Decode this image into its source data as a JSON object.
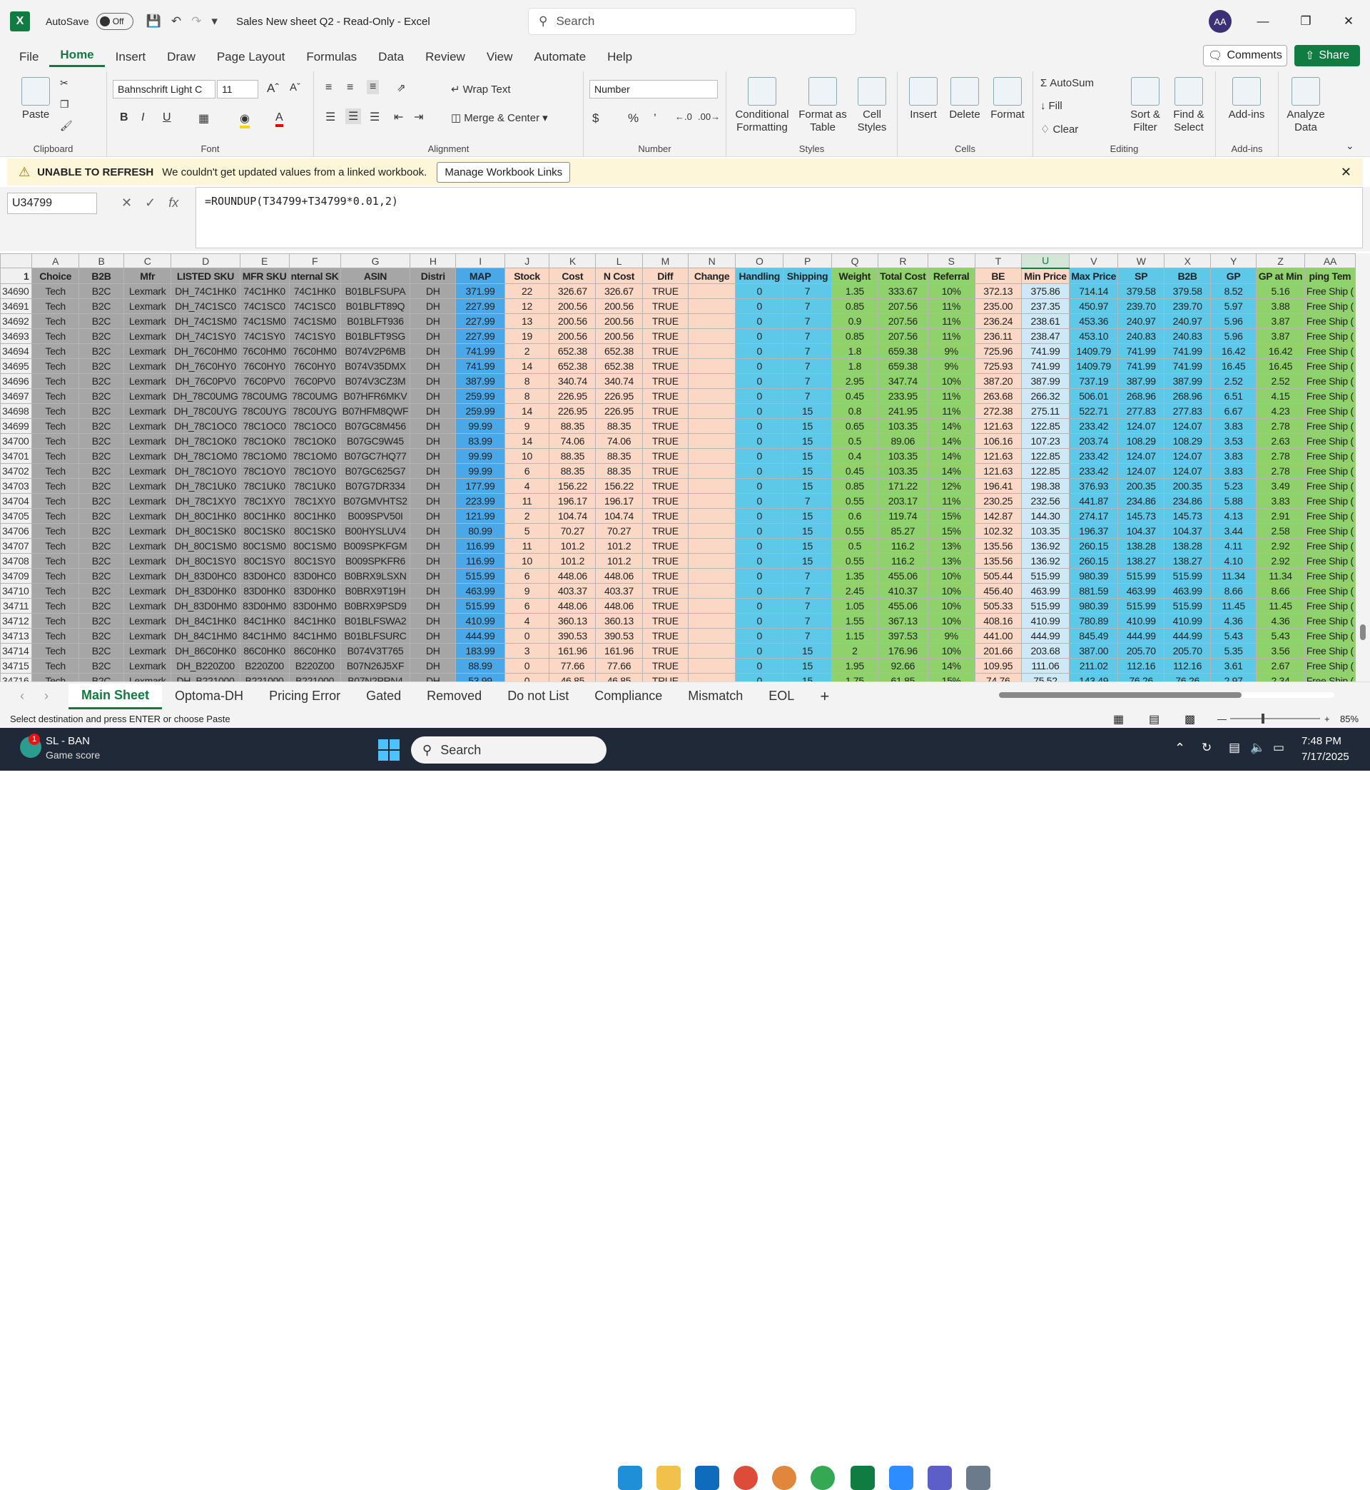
{
  "titlebar": {
    "autosave": "AutoSave",
    "toggle": "Off",
    "title": "Sales New sheet Q2  -  Read-Only  -  Excel",
    "search": "Search",
    "avatar": "AA"
  },
  "menu": [
    "File",
    "Home",
    "Insert",
    "Draw",
    "Page Layout",
    "Formulas",
    "Data",
    "Review",
    "View",
    "Automate",
    "Help"
  ],
  "comments": "Comments",
  "share": "Share",
  "ribbon": {
    "paste": "Paste",
    "clipboard": "Clipboard",
    "font_name": "Bahnschrift Light C",
    "font_size": "11",
    "font": "Font",
    "wrap": "Wrap Text",
    "merge": "Merge & Center",
    "alignment": "Alignment",
    "number_format": "Number",
    "number": "Number",
    "cond": "Conditional Formatting",
    "fmt_table": "Format as Table",
    "cell_styles": "Cell Styles",
    "styles": "Styles",
    "insert": "Insert",
    "delete": "Delete",
    "format": "Format",
    "cells": "Cells",
    "autosum": "AutoSum",
    "fill": "Fill",
    "clear": "Clear",
    "sort": "Sort & Filter",
    "find": "Find & Select",
    "editing": "Editing",
    "addins": "Add-ins",
    "addins_grp": "Add-ins",
    "analyze": "Analyze Data"
  },
  "warning": {
    "title": "UNABLE TO REFRESH",
    "message": "We couldn't get updated values from a linked workbook.",
    "button": "Manage Workbook Links"
  },
  "formula_bar": {
    "namebox": "U34799",
    "formula": "=ROUNDUP(T34799+T34799*0.01,2)"
  },
  "columns": [
    "A",
    "B",
    "C",
    "D",
    "E",
    "F",
    "G",
    "H",
    "I",
    "J",
    "K",
    "L",
    "M",
    "N",
    "O",
    "P",
    "Q",
    "R",
    "S",
    "T",
    "U",
    "V",
    "W",
    "X",
    "Y",
    "Z",
    "AA"
  ],
  "headers": [
    "Choice",
    "B2B",
    "Mfr",
    "LISTED SKU",
    "MFR SKU",
    "nternal SK",
    "ASIN",
    "Distri",
    "MAP",
    "Stock",
    "Cost",
    "N Cost",
    "Diff",
    "Change",
    "Handling",
    "Shipping",
    "Weight",
    "Total Cost",
    "Referral",
    "BE",
    "Min Price",
    "Max Price",
    "SP",
    "B2B",
    "GP",
    "GP at Min",
    "ping Tem"
  ],
  "rows": [
    [
      "34690",
      "Tech",
      "B2C",
      "Lexmark",
      "DH_74C1HK0",
      "74C1HK0",
      "74C1HK0",
      "B01BLFSUPA",
      "DH",
      "371.99",
      "22",
      "326.67",
      "326.67",
      "TRUE",
      "",
      "0",
      "7",
      "1.35",
      "333.67",
      "10%",
      "372.13",
      "375.86",
      "714.14",
      "379.58",
      "379.58",
      "8.52",
      "5.16",
      "Free Ship ("
    ],
    [
      "34691",
      "Tech",
      "B2C",
      "Lexmark",
      "DH_74C1SC0",
      "74C1SC0",
      "74C1SC0",
      "B01BLFT89Q",
      "DH",
      "227.99",
      "12",
      "200.56",
      "200.56",
      "TRUE",
      "",
      "0",
      "7",
      "0.85",
      "207.56",
      "11%",
      "235.00",
      "237.35",
      "450.97",
      "239.70",
      "239.70",
      "5.97",
      "3.88",
      "Free Ship ("
    ],
    [
      "34692",
      "Tech",
      "B2C",
      "Lexmark",
      "DH_74C1SM0",
      "74C1SM0",
      "74C1SM0",
      "B01BLFT936",
      "DH",
      "227.99",
      "13",
      "200.56",
      "200.56",
      "TRUE",
      "",
      "0",
      "7",
      "0.9",
      "207.56",
      "11%",
      "236.24",
      "238.61",
      "453.36",
      "240.97",
      "240.97",
      "5.96",
      "3.87",
      "Free Ship ("
    ],
    [
      "34693",
      "Tech",
      "B2C",
      "Lexmark",
      "DH_74C1SY0",
      "74C1SY0",
      "74C1SY0",
      "B01BLFT9SG",
      "DH",
      "227.99",
      "19",
      "200.56",
      "200.56",
      "TRUE",
      "",
      "0",
      "7",
      "0.85",
      "207.56",
      "11%",
      "236.11",
      "238.47",
      "453.10",
      "240.83",
      "240.83",
      "5.96",
      "3.87",
      "Free Ship ("
    ],
    [
      "34694",
      "Tech",
      "B2C",
      "Lexmark",
      "DH_76C0HM0",
      "76C0HM0",
      "76C0HM0",
      "B074V2P6MB",
      "DH",
      "741.99",
      "2",
      "652.38",
      "652.38",
      "TRUE",
      "",
      "0",
      "7",
      "1.8",
      "659.38",
      "9%",
      "725.96",
      "741.99",
      "1409.79",
      "741.99",
      "741.99",
      "16.42",
      "16.42",
      "Free Ship ("
    ],
    [
      "34695",
      "Tech",
      "B2C",
      "Lexmark",
      "DH_76C0HY0",
      "76C0HY0",
      "76C0HY0",
      "B074V35DMX",
      "DH",
      "741.99",
      "14",
      "652.38",
      "652.38",
      "TRUE",
      "",
      "0",
      "7",
      "1.8",
      "659.38",
      "9%",
      "725.93",
      "741.99",
      "1409.79",
      "741.99",
      "741.99",
      "16.45",
      "16.45",
      "Free Ship ("
    ],
    [
      "34696",
      "Tech",
      "B2C",
      "Lexmark",
      "DH_76C0PV0",
      "76C0PV0",
      "76C0PV0",
      "B074V3CZ3M",
      "DH",
      "387.99",
      "8",
      "340.74",
      "340.74",
      "TRUE",
      "",
      "0",
      "7",
      "2.95",
      "347.74",
      "10%",
      "387.20",
      "387.99",
      "737.19",
      "387.99",
      "387.99",
      "2.52",
      "2.52",
      "Free Ship ("
    ],
    [
      "34697",
      "Tech",
      "B2C",
      "Lexmark",
      "DH_78C0UMG",
      "78C0UMG",
      "78C0UMG",
      "B07HFR6MKV",
      "DH",
      "259.99",
      "8",
      "226.95",
      "226.95",
      "TRUE",
      "",
      "0",
      "7",
      "0.45",
      "233.95",
      "11%",
      "263.68",
      "266.32",
      "506.01",
      "268.96",
      "268.96",
      "6.51",
      "4.15",
      "Free Ship ("
    ],
    [
      "34698",
      "Tech",
      "B2C",
      "Lexmark",
      "DH_78C0UYG",
      "78C0UYG",
      "78C0UYG",
      "B07HFM8QWF",
      "DH",
      "259.99",
      "14",
      "226.95",
      "226.95",
      "TRUE",
      "",
      "0",
      "15",
      "0.8",
      "241.95",
      "11%",
      "272.38",
      "275.11",
      "522.71",
      "277.83",
      "277.83",
      "6.67",
      "4.23",
      "Free Ship ("
    ],
    [
      "34699",
      "Tech",
      "B2C",
      "Lexmark",
      "DH_78C1OC0",
      "78C1OC0",
      "78C1OC0",
      "B07GC8M456",
      "DH",
      "99.99",
      "9",
      "88.35",
      "88.35",
      "TRUE",
      "",
      "0",
      "15",
      "0.65",
      "103.35",
      "14%",
      "121.63",
      "122.85",
      "233.42",
      "124.07",
      "124.07",
      "3.83",
      "2.78",
      "Free Ship ("
    ],
    [
      "34700",
      "Tech",
      "B2C",
      "Lexmark",
      "DH_78C1OK0",
      "78C1OK0",
      "78C1OK0",
      "B07GC9W45",
      "DH",
      "83.99",
      "14",
      "74.06",
      "74.06",
      "TRUE",
      "",
      "0",
      "15",
      "0.5",
      "89.06",
      "14%",
      "106.16",
      "107.23",
      "203.74",
      "108.29",
      "108.29",
      "3.53",
      "2.63",
      "Free Ship ("
    ],
    [
      "34701",
      "Tech",
      "B2C",
      "Lexmark",
      "DH_78C1OM0",
      "78C1OM0",
      "78C1OM0",
      "B07GC7HQ77",
      "DH",
      "99.99",
      "10",
      "88.35",
      "88.35",
      "TRUE",
      "",
      "0",
      "15",
      "0.4",
      "103.35",
      "14%",
      "121.63",
      "122.85",
      "233.42",
      "124.07",
      "124.07",
      "3.83",
      "2.78",
      "Free Ship ("
    ],
    [
      "34702",
      "Tech",
      "B2C",
      "Lexmark",
      "DH_78C1OY0",
      "78C1OY0",
      "78C1OY0",
      "B07GC625G7",
      "DH",
      "99.99",
      "6",
      "88.35",
      "88.35",
      "TRUE",
      "",
      "0",
      "15",
      "0.45",
      "103.35",
      "14%",
      "121.63",
      "122.85",
      "233.42",
      "124.07",
      "124.07",
      "3.83",
      "2.78",
      "Free Ship ("
    ],
    [
      "34703",
      "Tech",
      "B2C",
      "Lexmark",
      "DH_78C1UK0",
      "78C1UK0",
      "78C1UK0",
      "B07G7DR334",
      "DH",
      "177.99",
      "4",
      "156.22",
      "156.22",
      "TRUE",
      "",
      "0",
      "15",
      "0.85",
      "171.22",
      "12%",
      "196.41",
      "198.38",
      "376.93",
      "200.35",
      "200.35",
      "5.23",
      "3.49",
      "Free Ship ("
    ],
    [
      "34704",
      "Tech",
      "B2C",
      "Lexmark",
      "DH_78C1XY0",
      "78C1XY0",
      "78C1XY0",
      "B07GMVHTS2",
      "DH",
      "223.99",
      "11",
      "196.17",
      "196.17",
      "TRUE",
      "",
      "0",
      "7",
      "0.55",
      "203.17",
      "11%",
      "230.25",
      "232.56",
      "441.87",
      "234.86",
      "234.86",
      "5.88",
      "3.83",
      "Free Ship ("
    ],
    [
      "34705",
      "Tech",
      "B2C",
      "Lexmark",
      "DH_80C1HK0",
      "80C1HK0",
      "80C1HK0",
      "B009SPV50I",
      "DH",
      "121.99",
      "2",
      "104.74",
      "104.74",
      "TRUE",
      "",
      "0",
      "15",
      "0.6",
      "119.74",
      "15%",
      "142.87",
      "144.30",
      "274.17",
      "145.73",
      "145.73",
      "4.13",
      "2.91",
      "Free Ship ("
    ],
    [
      "34706",
      "Tech",
      "B2C",
      "Lexmark",
      "DH_80C1SK0",
      "80C1SK0",
      "80C1SK0",
      "B00HYSLUV4",
      "DH",
      "80.99",
      "5",
      "70.27",
      "70.27",
      "TRUE",
      "",
      "0",
      "15",
      "0.55",
      "85.27",
      "15%",
      "102.32",
      "103.35",
      "196.37",
      "104.37",
      "104.37",
      "3.44",
      "2.58",
      "Free Ship ("
    ],
    [
      "34707",
      "Tech",
      "B2C",
      "Lexmark",
      "DH_80C1SM0",
      "80C1SM0",
      "80C1SM0",
      "B009SPKFGM",
      "DH",
      "116.99",
      "11",
      "101.2",
      "101.2",
      "TRUE",
      "",
      "0",
      "15",
      "0.5",
      "116.2",
      "13%",
      "135.56",
      "136.92",
      "260.15",
      "138.28",
      "138.28",
      "4.11",
      "2.92",
      "Free Ship ("
    ],
    [
      "34708",
      "Tech",
      "B2C",
      "Lexmark",
      "DH_80C1SY0",
      "80C1SY0",
      "80C1SY0",
      "B009SPKFR6",
      "DH",
      "116.99",
      "10",
      "101.2",
      "101.2",
      "TRUE",
      "",
      "0",
      "15",
      "0.55",
      "116.2",
      "13%",
      "135.56",
      "136.92",
      "260.15",
      "138.27",
      "138.27",
      "4.10",
      "2.92",
      "Free Ship ("
    ],
    [
      "34709",
      "Tech",
      "B2C",
      "Lexmark",
      "DH_83D0HC0",
      "83D0HC0",
      "83D0HC0",
      "B0BRX9LSXN",
      "DH",
      "515.99",
      "6",
      "448.06",
      "448.06",
      "TRUE",
      "",
      "0",
      "7",
      "1.35",
      "455.06",
      "10%",
      "505.44",
      "515.99",
      "980.39",
      "515.99",
      "515.99",
      "11.34",
      "11.34",
      "Free Ship ("
    ],
    [
      "34710",
      "Tech",
      "B2C",
      "Lexmark",
      "DH_83D0HK0",
      "83D0HK0",
      "83D0HK0",
      "B0BRX9T19H",
      "DH",
      "463.99",
      "9",
      "403.37",
      "403.37",
      "TRUE",
      "",
      "0",
      "7",
      "2.45",
      "410.37",
      "10%",
      "456.40",
      "463.99",
      "881.59",
      "463.99",
      "463.99",
      "8.66",
      "8.66",
      "Free Ship ("
    ],
    [
      "34711",
      "Tech",
      "B2C",
      "Lexmark",
      "DH_83D0HM0",
      "83D0HM0",
      "83D0HM0",
      "B0BRX9PSD9",
      "DH",
      "515.99",
      "6",
      "448.06",
      "448.06",
      "TRUE",
      "",
      "0",
      "7",
      "1.05",
      "455.06",
      "10%",
      "505.33",
      "515.99",
      "980.39",
      "515.99",
      "515.99",
      "11.45",
      "11.45",
      "Free Ship ("
    ],
    [
      "34712",
      "Tech",
      "B2C",
      "Lexmark",
      "DH_84C1HK0",
      "84C1HK0",
      "84C1HK0",
      "B01BLFSWA2",
      "DH",
      "410.99",
      "4",
      "360.13",
      "360.13",
      "TRUE",
      "",
      "0",
      "7",
      "1.55",
      "367.13",
      "10%",
      "408.16",
      "410.99",
      "780.89",
      "410.99",
      "410.99",
      "4.36",
      "4.36",
      "Free Ship ("
    ],
    [
      "34713",
      "Tech",
      "B2C",
      "Lexmark",
      "DH_84C1HM0",
      "84C1HM0",
      "84C1HM0",
      "B01BLFSURC",
      "DH",
      "444.99",
      "0",
      "390.53",
      "390.53",
      "TRUE",
      "",
      "0",
      "7",
      "1.15",
      "397.53",
      "9%",
      "441.00",
      "444.99",
      "845.49",
      "444.99",
      "444.99",
      "5.43",
      "5.43",
      "Free Ship ("
    ],
    [
      "34714",
      "Tech",
      "B2C",
      "Lexmark",
      "DH_86C0HK0",
      "86C0HK0",
      "86C0HK0",
      "B074V3T765",
      "DH",
      "183.99",
      "3",
      "161.96",
      "161.96",
      "TRUE",
      "",
      "0",
      "15",
      "2",
      "176.96",
      "10%",
      "201.66",
      "203.68",
      "387.00",
      "205.70",
      "205.70",
      "5.35",
      "3.56",
      "Free Ship ("
    ],
    [
      "34715",
      "Tech",
      "B2C",
      "Lexmark",
      "DH_B220Z00",
      "B220Z00",
      "B220Z00",
      "B07N26J5XF",
      "DH",
      "88.99",
      "0",
      "77.66",
      "77.66",
      "TRUE",
      "",
      "0",
      "15",
      "1.95",
      "92.66",
      "14%",
      "109.95",
      "111.06",
      "211.02",
      "112.16",
      "112.16",
      "3.61",
      "2.67",
      "Free Ship ("
    ],
    [
      "34716",
      "Tech",
      "B2C",
      "Lexmark",
      "DH_B221000",
      "B221000",
      "B221000",
      "B07N2PRN4",
      "DH",
      "53.99",
      "0",
      "46.85",
      "46.85",
      "TRUE",
      "",
      "0",
      "15",
      "1.75",
      "61.85",
      "15%",
      "74.76",
      "75.52",
      "143.49",
      "76.26",
      "76.26",
      "2.97",
      "2.34",
      "Free Ship ("
    ]
  ],
  "sheets": [
    "Main Sheet",
    "Optoma-DH",
    "Pricing Error",
    "Gated",
    "Removed",
    "Do not List",
    "Compliance",
    "Mismatch",
    "EOL"
  ],
  "add_sheet": "+",
  "status": {
    "message": "Select destination and press ENTER or choose Paste",
    "zoom": "85%"
  },
  "taskbar": {
    "weather_title": "SL - BAN",
    "weather_sub": "Game score",
    "badge": "1",
    "search": "Search",
    "time": "7:48 PM",
    "date": "7/17/2025"
  },
  "colors": {
    "excel_green": "#107c41",
    "grey_cols": "#a6a6a6",
    "blue": "#4aa8e8",
    "peach": "#fbd8c6",
    "green": "#8fd16a",
    "cyan": "#5ec8e8"
  }
}
